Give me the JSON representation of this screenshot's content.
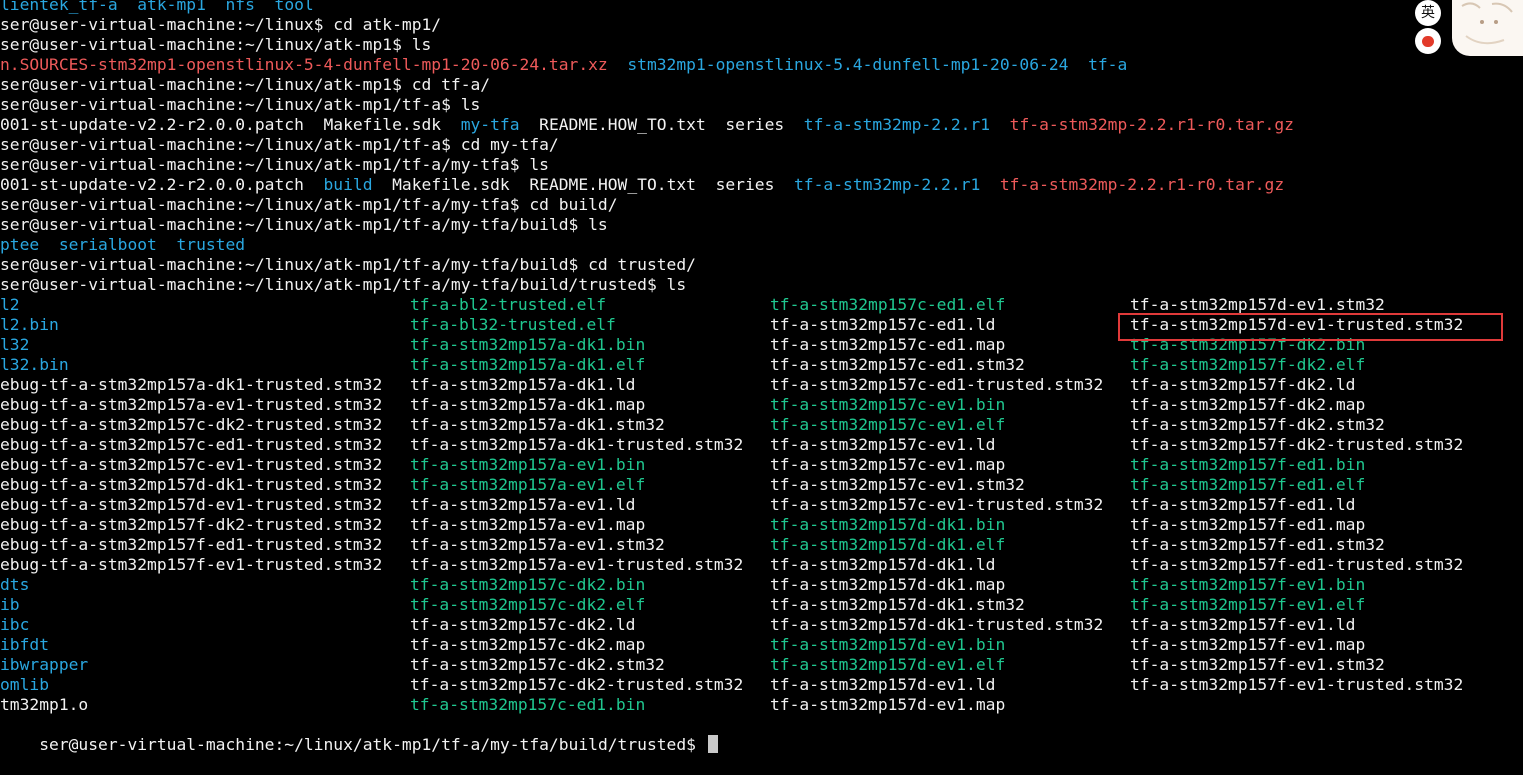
{
  "terminal": {
    "lines": [
      {
        "segments": [
          {
            "text": "lientek_tf-a",
            "type": "dir"
          },
          {
            "text": "  ",
            "type": "plain"
          },
          {
            "text": "atk-mp1",
            "type": "dir"
          },
          {
            "text": "  ",
            "type": "plain"
          },
          {
            "text": "nfs",
            "type": "dir"
          },
          {
            "text": "  ",
            "type": "plain"
          },
          {
            "text": "tool",
            "type": "dir"
          }
        ]
      },
      {
        "segments": [
          {
            "text": "ser@user-virtual-machine:~/linux$ cd atk-mp1/",
            "type": "plain"
          }
        ]
      },
      {
        "segments": [
          {
            "text": "ser@user-virtual-machine:~/linux/atk-mp1$ ls",
            "type": "plain"
          }
        ]
      },
      {
        "segments": [
          {
            "text": "n.SOURCES-stm32mp1-openstlinux-5-4-dunfell-mp1-20-06-24.tar.xz",
            "type": "arch"
          },
          {
            "text": "  ",
            "type": "plain"
          },
          {
            "text": "stm32mp1-openstlinux-5.4-dunfell-mp1-20-06-24",
            "type": "dir"
          },
          {
            "text": "  ",
            "type": "plain"
          },
          {
            "text": "tf-a",
            "type": "dir"
          }
        ]
      },
      {
        "segments": [
          {
            "text": "ser@user-virtual-machine:~/linux/atk-mp1$ cd tf-a/",
            "type": "plain"
          }
        ]
      },
      {
        "segments": [
          {
            "text": "ser@user-virtual-machine:~/linux/atk-mp1/tf-a$ ls",
            "type": "plain"
          }
        ]
      },
      {
        "segments": [
          {
            "text": "001-st-update-v2.2-r2.0.0.patch  Makefile.sdk  ",
            "type": "plain"
          },
          {
            "text": "my-tfa",
            "type": "dir"
          },
          {
            "text": "  README.HOW_TO.txt  series  ",
            "type": "plain"
          },
          {
            "text": "tf-a-stm32mp-2.2.r1",
            "type": "dir"
          },
          {
            "text": "  ",
            "type": "plain"
          },
          {
            "text": "tf-a-stm32mp-2.2.r1-r0.tar.gz",
            "type": "arch"
          }
        ]
      },
      {
        "segments": [
          {
            "text": "ser@user-virtual-machine:~/linux/atk-mp1/tf-a$ cd my-tfa/",
            "type": "plain"
          }
        ]
      },
      {
        "segments": [
          {
            "text": "ser@user-virtual-machine:~/linux/atk-mp1/tf-a/my-tfa$ ls",
            "type": "plain"
          }
        ]
      },
      {
        "segments": [
          {
            "text": "001-st-update-v2.2-r2.0.0.patch  ",
            "type": "plain"
          },
          {
            "text": "build",
            "type": "dir"
          },
          {
            "text": "  Makefile.sdk  README.HOW_TO.txt  series  ",
            "type": "plain"
          },
          {
            "text": "tf-a-stm32mp-2.2.r1",
            "type": "dir"
          },
          {
            "text": "  ",
            "type": "plain"
          },
          {
            "text": "tf-a-stm32mp-2.2.r1-r0.tar.gz",
            "type": "arch"
          }
        ]
      },
      {
        "segments": [
          {
            "text": "ser@user-virtual-machine:~/linux/atk-mp1/tf-a/my-tfa$ cd build/",
            "type": "plain"
          }
        ]
      },
      {
        "segments": [
          {
            "text": "ser@user-virtual-machine:~/linux/atk-mp1/tf-a/my-tfa/build$ ls",
            "type": "plain"
          }
        ]
      },
      {
        "segments": [
          {
            "text": "ptee",
            "type": "dir"
          },
          {
            "text": "  ",
            "type": "plain"
          },
          {
            "text": "serialboot",
            "type": "dir"
          },
          {
            "text": "  ",
            "type": "plain"
          },
          {
            "text": "trusted",
            "type": "dir"
          }
        ]
      },
      {
        "segments": [
          {
            "text": "ser@user-virtual-machine:~/linux/atk-mp1/tf-a/my-tfa/build$ cd trusted/",
            "type": "plain"
          }
        ]
      },
      {
        "segments": [
          {
            "text": "ser@user-virtual-machine:~/linux/atk-mp1/tf-a/my-tfa/build/trusted$ ls",
            "type": "plain"
          }
        ]
      }
    ],
    "listing": [
      [
        {
          "text": "l2",
          "type": "dir"
        },
        {
          "text": "tf-a-bl2-trusted.elf",
          "type": "exe"
        },
        {
          "text": "tf-a-stm32mp157c-ed1.elf",
          "type": "exe"
        },
        {
          "text": "tf-a-stm32mp157d-ev1.stm32",
          "type": "plain"
        }
      ],
      [
        {
          "text": "l2.bin",
          "type": "dir"
        },
        {
          "text": "tf-a-bl32-trusted.elf",
          "type": "exe"
        },
        {
          "text": "tf-a-stm32mp157c-ed1.ld",
          "type": "plain"
        },
        {
          "text": "tf-a-stm32mp157d-ev1-trusted.stm32",
          "type": "plain"
        }
      ],
      [
        {
          "text": "l32",
          "type": "dir"
        },
        {
          "text": "tf-a-stm32mp157a-dk1.bin",
          "type": "exe"
        },
        {
          "text": "tf-a-stm32mp157c-ed1.map",
          "type": "plain"
        },
        {
          "text": "tf-a-stm32mp157f-dk2.bin",
          "type": "exe"
        }
      ],
      [
        {
          "text": "l32.bin",
          "type": "dir"
        },
        {
          "text": "tf-a-stm32mp157a-dk1.elf",
          "type": "exe"
        },
        {
          "text": "tf-a-stm32mp157c-ed1.stm32",
          "type": "plain"
        },
        {
          "text": "tf-a-stm32mp157f-dk2.elf",
          "type": "exe"
        }
      ],
      [
        {
          "text": "ebug-tf-a-stm32mp157a-dk1-trusted.stm32",
          "type": "plain"
        },
        {
          "text": "tf-a-stm32mp157a-dk1.ld",
          "type": "plain"
        },
        {
          "text": "tf-a-stm32mp157c-ed1-trusted.stm32",
          "type": "plain"
        },
        {
          "text": "tf-a-stm32mp157f-dk2.ld",
          "type": "plain"
        }
      ],
      [
        {
          "text": "ebug-tf-a-stm32mp157a-ev1-trusted.stm32",
          "type": "plain"
        },
        {
          "text": "tf-a-stm32mp157a-dk1.map",
          "type": "plain"
        },
        {
          "text": "tf-a-stm32mp157c-ev1.bin",
          "type": "exe"
        },
        {
          "text": "tf-a-stm32mp157f-dk2.map",
          "type": "plain"
        }
      ],
      [
        {
          "text": "ebug-tf-a-stm32mp157c-dk2-trusted.stm32",
          "type": "plain"
        },
        {
          "text": "tf-a-stm32mp157a-dk1.stm32",
          "type": "plain"
        },
        {
          "text": "tf-a-stm32mp157c-ev1.elf",
          "type": "exe"
        },
        {
          "text": "tf-a-stm32mp157f-dk2.stm32",
          "type": "plain"
        }
      ],
      [
        {
          "text": "ebug-tf-a-stm32mp157c-ed1-trusted.stm32",
          "type": "plain"
        },
        {
          "text": "tf-a-stm32mp157a-dk1-trusted.stm32",
          "type": "plain"
        },
        {
          "text": "tf-a-stm32mp157c-ev1.ld",
          "type": "plain"
        },
        {
          "text": "tf-a-stm32mp157f-dk2-trusted.stm32",
          "type": "plain"
        }
      ],
      [
        {
          "text": "ebug-tf-a-stm32mp157c-ev1-trusted.stm32",
          "type": "plain"
        },
        {
          "text": "tf-a-stm32mp157a-ev1.bin",
          "type": "exe"
        },
        {
          "text": "tf-a-stm32mp157c-ev1.map",
          "type": "plain"
        },
        {
          "text": "tf-a-stm32mp157f-ed1.bin",
          "type": "exe"
        }
      ],
      [
        {
          "text": "ebug-tf-a-stm32mp157d-dk1-trusted.stm32",
          "type": "plain"
        },
        {
          "text": "tf-a-stm32mp157a-ev1.elf",
          "type": "exe"
        },
        {
          "text": "tf-a-stm32mp157c-ev1.stm32",
          "type": "plain"
        },
        {
          "text": "tf-a-stm32mp157f-ed1.elf",
          "type": "exe"
        }
      ],
      [
        {
          "text": "ebug-tf-a-stm32mp157d-ev1-trusted.stm32",
          "type": "plain"
        },
        {
          "text": "tf-a-stm32mp157a-ev1.ld",
          "type": "plain"
        },
        {
          "text": "tf-a-stm32mp157c-ev1-trusted.stm32",
          "type": "plain"
        },
        {
          "text": "tf-a-stm32mp157f-ed1.ld",
          "type": "plain"
        }
      ],
      [
        {
          "text": "ebug-tf-a-stm32mp157f-dk2-trusted.stm32",
          "type": "plain"
        },
        {
          "text": "tf-a-stm32mp157a-ev1.map",
          "type": "plain"
        },
        {
          "text": "tf-a-stm32mp157d-dk1.bin",
          "type": "exe"
        },
        {
          "text": "tf-a-stm32mp157f-ed1.map",
          "type": "plain"
        }
      ],
      [
        {
          "text": "ebug-tf-a-stm32mp157f-ed1-trusted.stm32",
          "type": "plain"
        },
        {
          "text": "tf-a-stm32mp157a-ev1.stm32",
          "type": "plain"
        },
        {
          "text": "tf-a-stm32mp157d-dk1.elf",
          "type": "exe"
        },
        {
          "text": "tf-a-stm32mp157f-ed1.stm32",
          "type": "plain"
        }
      ],
      [
        {
          "text": "ebug-tf-a-stm32mp157f-ev1-trusted.stm32",
          "type": "plain"
        },
        {
          "text": "tf-a-stm32mp157a-ev1-trusted.stm32",
          "type": "plain"
        },
        {
          "text": "tf-a-stm32mp157d-dk1.ld",
          "type": "plain"
        },
        {
          "text": "tf-a-stm32mp157f-ed1-trusted.stm32",
          "type": "plain"
        }
      ],
      [
        {
          "text": "dts",
          "type": "dir"
        },
        {
          "text": "tf-a-stm32mp157c-dk2.bin",
          "type": "exe"
        },
        {
          "text": "tf-a-stm32mp157d-dk1.map",
          "type": "plain"
        },
        {
          "text": "tf-a-stm32mp157f-ev1.bin",
          "type": "exe"
        }
      ],
      [
        {
          "text": "ib",
          "type": "dir"
        },
        {
          "text": "tf-a-stm32mp157c-dk2.elf",
          "type": "exe"
        },
        {
          "text": "tf-a-stm32mp157d-dk1.stm32",
          "type": "plain"
        },
        {
          "text": "tf-a-stm32mp157f-ev1.elf",
          "type": "exe"
        }
      ],
      [
        {
          "text": "ibc",
          "type": "dir"
        },
        {
          "text": "tf-a-stm32mp157c-dk2.ld",
          "type": "plain"
        },
        {
          "text": "tf-a-stm32mp157d-dk1-trusted.stm32",
          "type": "plain"
        },
        {
          "text": "tf-a-stm32mp157f-ev1.ld",
          "type": "plain"
        }
      ],
      [
        {
          "text": "ibfdt",
          "type": "dir"
        },
        {
          "text": "tf-a-stm32mp157c-dk2.map",
          "type": "plain"
        },
        {
          "text": "tf-a-stm32mp157d-ev1.bin",
          "type": "exe"
        },
        {
          "text": "tf-a-stm32mp157f-ev1.map",
          "type": "plain"
        }
      ],
      [
        {
          "text": "ibwrapper",
          "type": "dir"
        },
        {
          "text": "tf-a-stm32mp157c-dk2.stm32",
          "type": "plain"
        },
        {
          "text": "tf-a-stm32mp157d-ev1.elf",
          "type": "exe"
        },
        {
          "text": "tf-a-stm32mp157f-ev1.stm32",
          "type": "plain"
        }
      ],
      [
        {
          "text": "omlib",
          "type": "dir"
        },
        {
          "text": "tf-a-stm32mp157c-dk2-trusted.stm32",
          "type": "plain"
        },
        {
          "text": "tf-a-stm32mp157d-ev1.ld",
          "type": "plain"
        },
        {
          "text": "tf-a-stm32mp157f-ev1-trusted.stm32",
          "type": "plain"
        }
      ],
      [
        {
          "text": "tm32mp1.o",
          "type": "plain"
        },
        {
          "text": "tf-a-stm32mp157c-ed1.bin",
          "type": "exe"
        },
        {
          "text": "tf-a-stm32mp157d-ev1.map",
          "type": "plain"
        },
        {
          "text": "",
          "type": "plain"
        }
      ]
    ],
    "prompt": "ser@user-virtual-machine:~/linux/atk-mp1/tf-a/my-tfa/build/trusted$ "
  },
  "ime": {
    "lang_label": "英",
    "lang_icon": "language-toggle-icon",
    "skin_icon": "skin-icon",
    "mascot_icon": "mascot-icon"
  },
  "colors": {
    "background": "#000000",
    "text": "#f2f2f2",
    "directory": "#2aa7e0",
    "executable": "#20c890",
    "archive": "#ee5a5a",
    "highlight_box": "#e03a3a"
  }
}
